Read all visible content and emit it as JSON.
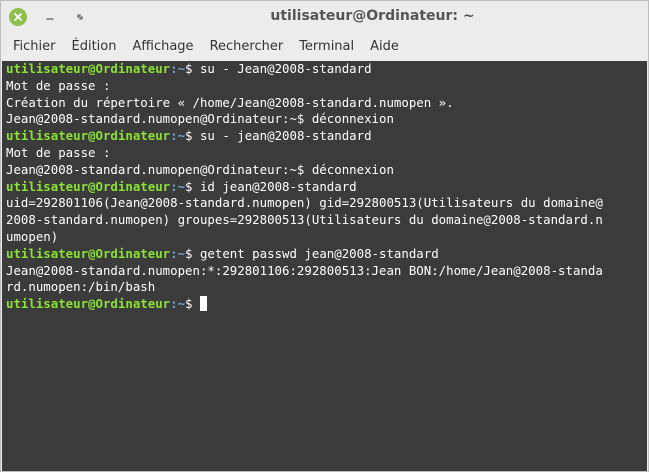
{
  "window": {
    "title": "utilisateur@Ordinateur: ~"
  },
  "menu": {
    "items": [
      "Fichier",
      "Édition",
      "Affichage",
      "Rechercher",
      "Terminal",
      "Aide"
    ]
  },
  "terminal": {
    "lines": [
      {
        "user": "utilisateur@Ordinateur",
        "path": ":~",
        "text": "$ su - Jean@2008-standard"
      },
      {
        "text": "Mot de passe :"
      },
      {
        "text": "Création du répertoire « /home/Jean@2008-standard.numopen »."
      },
      {
        "text": "Jean@2008-standard.numopen@Ordinateur:~$ déconnexion"
      },
      {
        "user": "utilisateur@Ordinateur",
        "path": ":~",
        "text": "$ su - jean@2008-standard"
      },
      {
        "text": "Mot de passe :"
      },
      {
        "text": "Jean@2008-standard.numopen@Ordinateur:~$ déconnexion"
      },
      {
        "user": "utilisateur@Ordinateur",
        "path": ":~",
        "text": "$ id jean@2008-standard"
      },
      {
        "text": "uid=292801106(Jean@2008-standard.numopen) gid=292800513(Utilisateurs du domaine@"
      },
      {
        "text": "2008-standard.numopen) groupes=292800513(Utilisateurs du domaine@2008-standard.n"
      },
      {
        "text": "umopen)"
      },
      {
        "user": "utilisateur@Ordinateur",
        "path": ":~",
        "text": "$ getent passwd jean@2008-standard"
      },
      {
        "text": "Jean@2008-standard.numopen:*:292801106:292800513:Jean BON:/home/Jean@2008-standa"
      },
      {
        "text": "rd.numopen:/bin/bash"
      },
      {
        "user": "utilisateur@Ordinateur",
        "path": ":~",
        "text": "$ ",
        "cursor": true
      }
    ]
  },
  "colors": {
    "prompt_user": "#8ae234",
    "prompt_path": "#729fcf",
    "terminal_bg": "#3b3b3b",
    "close_button": "#8fbf4e"
  }
}
